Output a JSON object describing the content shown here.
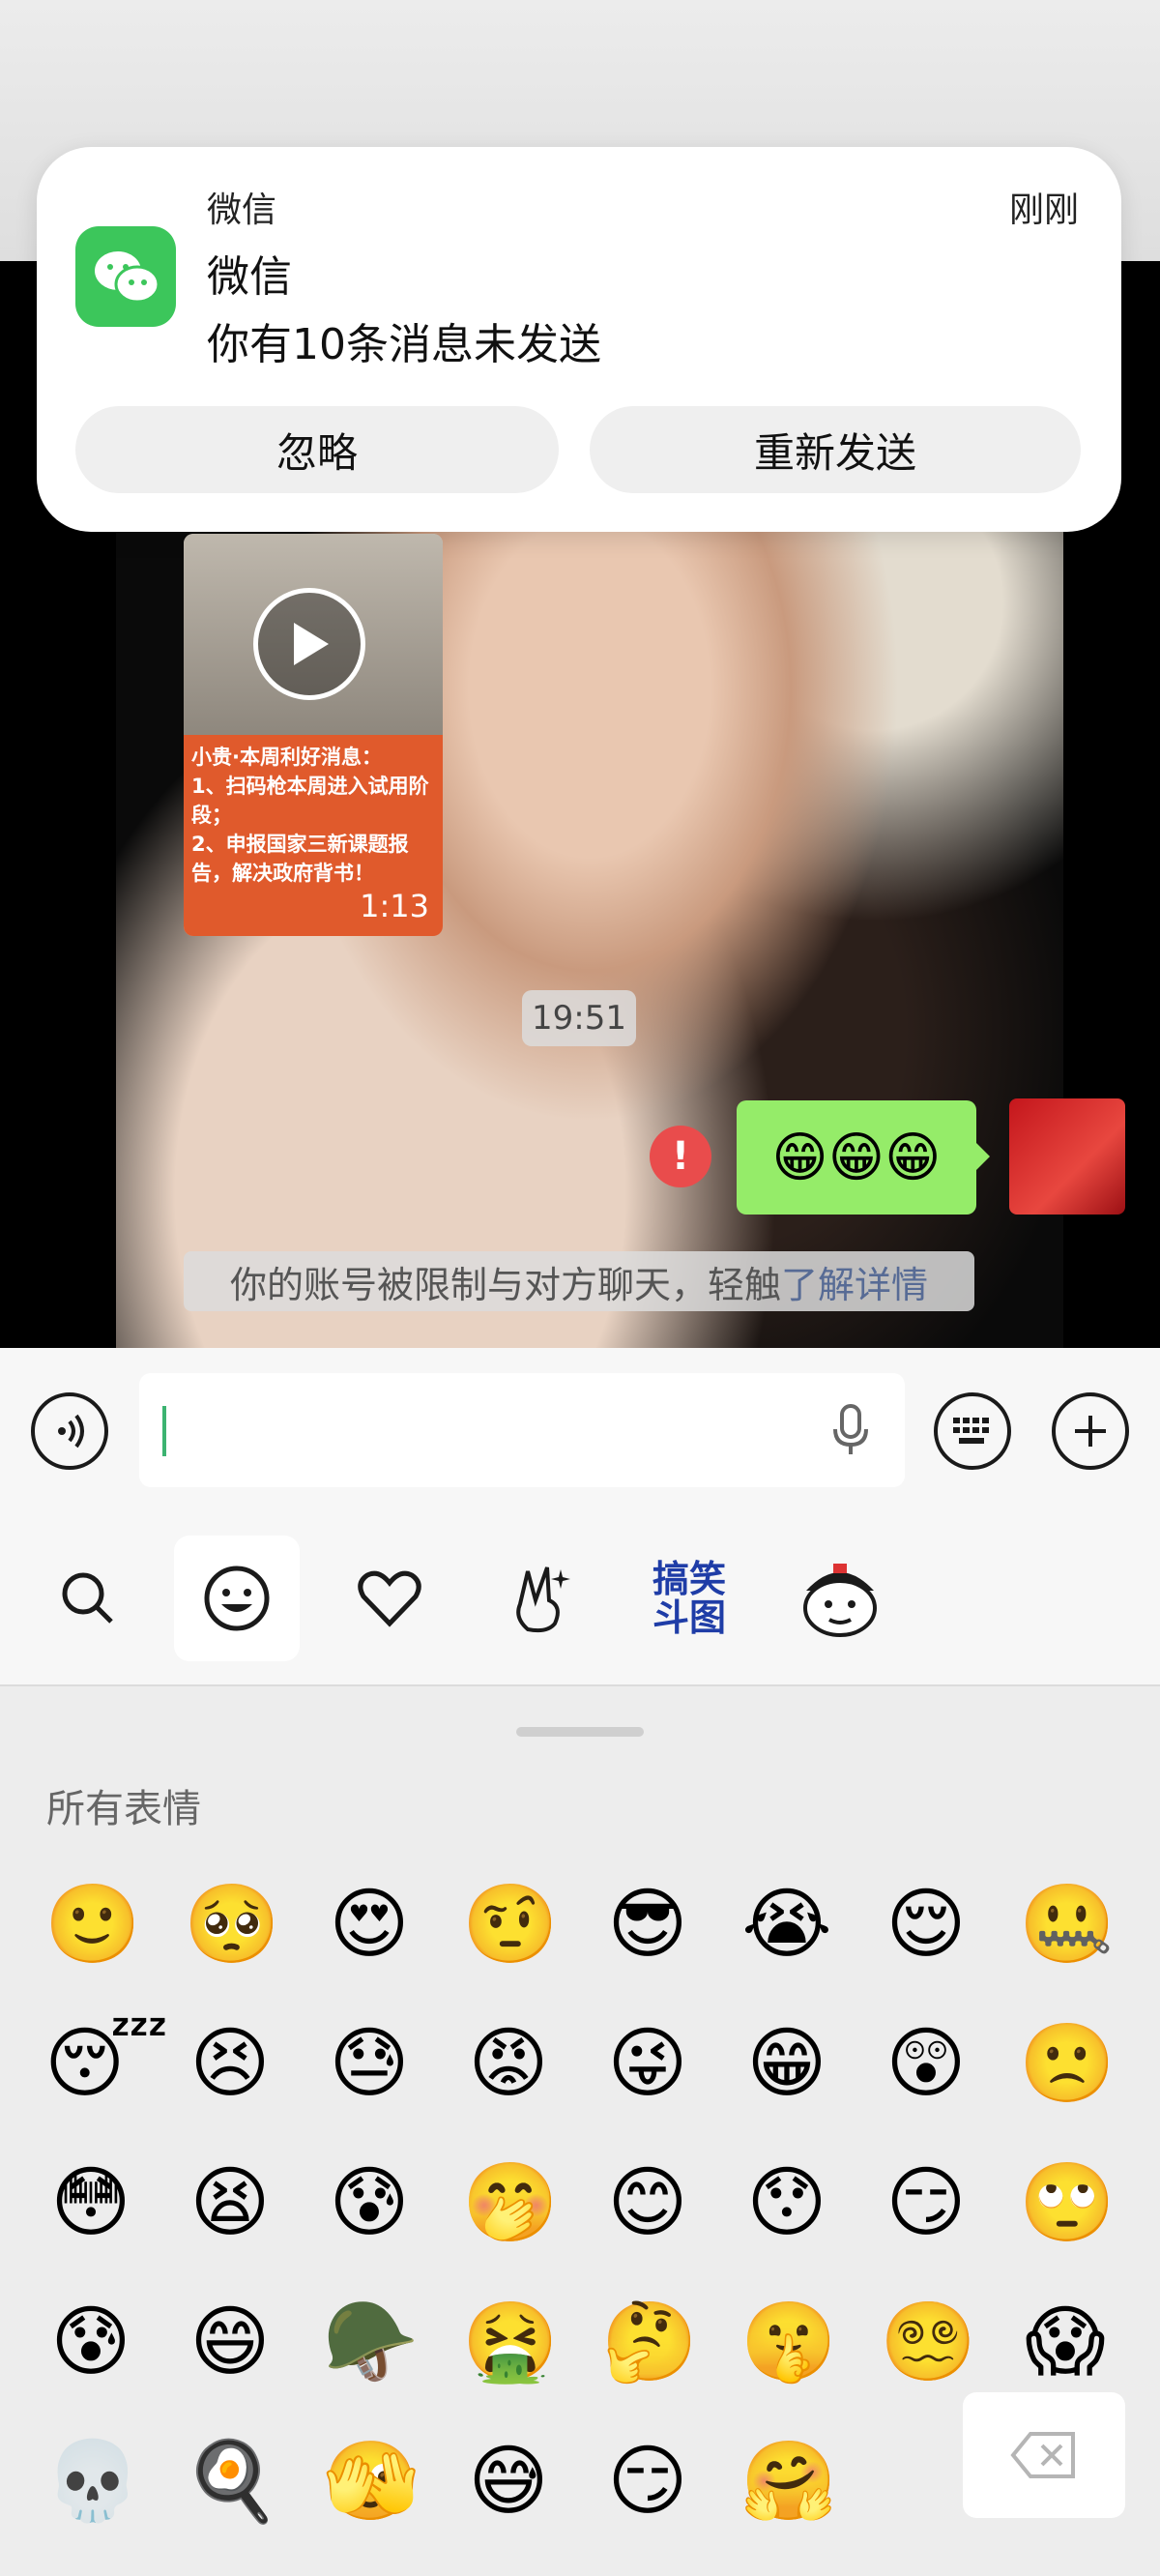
{
  "notification": {
    "app_name": "微信",
    "time": "刚刚",
    "title": "微信",
    "message": "你有10条消息未发送",
    "ignore_label": "忽略",
    "resend_label": "重新发送"
  },
  "chat": {
    "video_caption": "小贵·本周利好消息：\n1、扫码枪本周进入试用阶段；\n2、申报国家三新课题报告，解决政府背书！",
    "video_duration": "1:13",
    "timestamp": "19:51",
    "error_mark": "!",
    "sent_message": "😁😁😁",
    "system_notice": "你的账号被限制与对方聊天，轻触",
    "system_notice_link": "了解详情"
  },
  "emoji_panel": {
    "sticker_tab_label": "搞笑\n斗图",
    "section_title": "所有表情",
    "emojis": [
      "🙂",
      "🥺",
      "😍",
      "🤨",
      "😎",
      "😭",
      "😌",
      "🤐",
      "😴",
      "😣",
      "😓",
      "😡",
      "😜",
      "😁",
      "😲",
      "🙁",
      "😳",
      "😫",
      "😰",
      "🤭",
      "😊",
      "😯",
      "😏",
      "🙄",
      "😰",
      "😄",
      "🪖",
      "🤮",
      "🤔",
      "🤫",
      "😵‍💫",
      "😱",
      "💀",
      "🍳",
      "🫣",
      "😅",
      "😏",
      "🤗"
    ]
  },
  "colors": {
    "bubble_green": "#95ec69",
    "wechat_green": "#3cc65b",
    "error_red": "#e94c4c",
    "link_blue": "#576b95"
  }
}
